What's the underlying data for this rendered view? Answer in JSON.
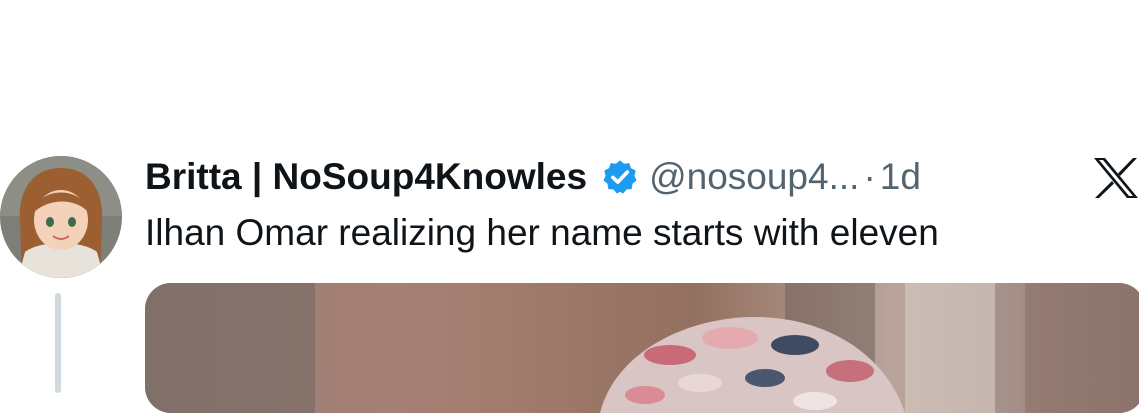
{
  "tweet": {
    "author": {
      "display_name": "Britta | NoSoup4Knowles",
      "handle": "@nosoup4...",
      "verified": true,
      "avatar_icon": "profile-photo-cartoon-woman"
    },
    "separator": "·",
    "time": "1d",
    "text": "Ilhan Omar realizing her name starts with eleven",
    "platform_icon": "x-logo-icon",
    "media_icon": "photo-thumbnail",
    "colors": {
      "primary_text": "#0f1419",
      "secondary_text": "#536471",
      "verified_blue": "#1d9bf0",
      "thread_line": "#cfd9de"
    }
  }
}
